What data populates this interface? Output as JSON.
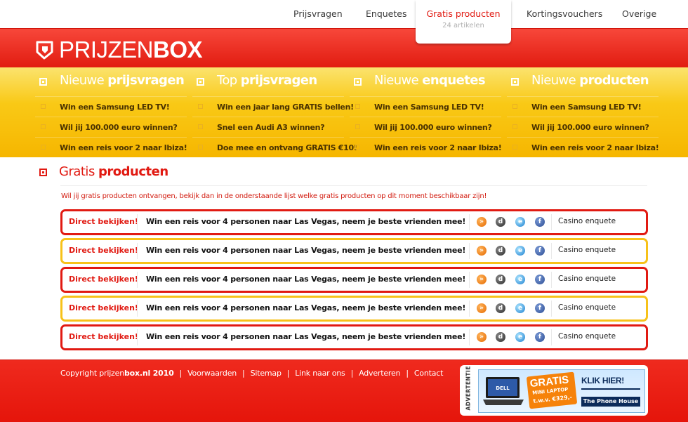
{
  "topnav": {
    "items": [
      {
        "label": "Prijsvragen"
      },
      {
        "label": "Enquetes"
      },
      {
        "label": "Gratis producten",
        "sub": "24 artikelen"
      },
      {
        "label": "Kortingsvouchers"
      },
      {
        "label": "Overige"
      }
    ]
  },
  "brand": {
    "light": "PRIJZEN",
    "bold": "BOX",
    "icon": "prijzenbox-logo-icon"
  },
  "promo_columns": [
    {
      "title_light": "Nieuwe ",
      "title_bold": "prijsvragen",
      "links": [
        "Win een Samsung LED TV!",
        "Wil jij 100.000 euro winnen?",
        "Win een reis voor 2 naar Ibiza!"
      ]
    },
    {
      "title_light": "Top ",
      "title_bold": "prijsvragen",
      "links": [
        "Win een jaar lang GRATIS bellen!",
        "Snel een Audi A3 winnen?",
        "Doe mee en ontvang GRATIS €10!"
      ]
    },
    {
      "title_light": "Nieuwe ",
      "title_bold": "enquetes",
      "links": [
        "Win een Samsung LED TV!",
        "Wil jij 100.000 euro winnen?",
        "Win een reis voor 2 naar Ibiza!"
      ]
    },
    {
      "title_light": "Nieuwe ",
      "title_bold": "producten",
      "links": [
        "Win een Samsung LED TV!",
        "Wil jij 100.000 euro winnen?",
        "Win een reis voor 2 naar Ibiza!"
      ]
    }
  ],
  "section": {
    "title_light": "Gratis ",
    "title_bold": "producten",
    "intro": "Wil jij gratis producten ontvangen, bekijk dan in de onderstaande lijst welke gratis producten op dit moment beschikbaar zijn!"
  },
  "listings": [
    {
      "cta": "Direct bekijken!",
      "text": "Win een reis voor 4 personen naar Las Vegas, neem je beste vrienden mee!",
      "category": "Casino enquete",
      "border": "red"
    },
    {
      "cta": "Direct bekijken!",
      "text": "Win een reis voor 4 personen naar Las Vegas, neem je beste vrienden mee!",
      "category": "Casino enquete",
      "border": "yellow"
    },
    {
      "cta": "Direct bekijken!",
      "text": "Win een reis voor 4 personen naar Las Vegas, neem je beste vrienden mee!",
      "category": "Casino enquete",
      "border": "red"
    },
    {
      "cta": "Direct bekijken!",
      "text": "Win een reis voor 4 personen naar Las Vegas, neem je beste vrienden mee!",
      "category": "Casino enquete",
      "border": "yellow"
    },
    {
      "cta": "Direct bekijken!",
      "text": "Win een reis voor 4 personen naar Las Vegas, neem je beste vrienden mee!",
      "category": "Casino enquete",
      "border": "red"
    }
  ],
  "share_icons": [
    "rss-icon",
    "digg-icon",
    "delicious-icon",
    "facebook-icon"
  ],
  "footer": {
    "copyright_light": "Copyright prijzen",
    "copyright_bold": "box.nl 2010",
    "links": [
      "Voorwaarden",
      "Sitemap",
      "Link naar ons",
      "Adverteren",
      "Contact"
    ]
  },
  "ad": {
    "vertical_label": "ADVERTENTIE",
    "badge_title": "GRATIS",
    "badge_sub": "MINI LAPTOP",
    "badge_price": "t.w.v. €329,-",
    "cta": "KLIK HIER!",
    "brand": "The Phone House",
    "laptop_brand": "DELL"
  },
  "colors": {
    "red": "#e11a12",
    "yellow": "#f7c21a",
    "dark_text": "#4a3200"
  }
}
